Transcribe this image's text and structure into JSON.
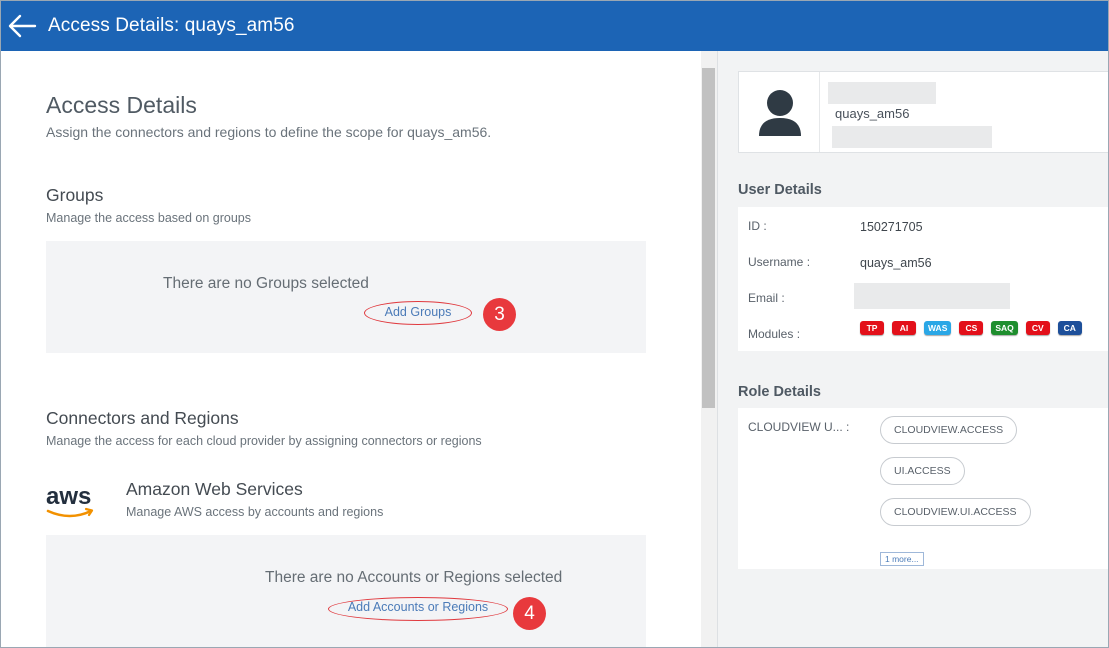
{
  "header": {
    "title": "Access Details: quays_am56"
  },
  "main": {
    "title": "Access Details",
    "subtitle": "Assign the connectors and regions to define the scope for quays_am56.",
    "groups": {
      "title": "Groups",
      "subtitle": "Manage the access based on groups",
      "empty_message": "There are no Groups selected",
      "add_label": "Add Groups",
      "step": "3"
    },
    "connectors": {
      "title": "Connectors and Regions",
      "subtitle": "Manage the access for each cloud provider by assigning connectors or regions",
      "aws": {
        "logo_text": "aws",
        "title": "Amazon Web Services",
        "subtitle": "Manage AWS access by accounts and regions",
        "empty_message": "There are no Accounts or Regions selected",
        "add_label": "Add Accounts or Regions",
        "step": "4"
      }
    }
  },
  "profile": {
    "username": "quays_am56"
  },
  "user_details": {
    "title": "User Details",
    "id_label": "ID",
    "id_value": "150271705",
    "username_label": "Username",
    "username_value": "quays_am56",
    "email_label": "Email",
    "modules_label": "Modules",
    "modules": [
      {
        "label": "TP",
        "color": "#e3101a"
      },
      {
        "label": "AI",
        "color": "#e3101a"
      },
      {
        "label": "WAS",
        "color": "#2aa7e6"
      },
      {
        "label": "CS",
        "color": "#e3101a"
      },
      {
        "label": "SAQ",
        "color": "#1e8e2e"
      },
      {
        "label": "CV",
        "color": "#e3101a"
      },
      {
        "label": "CA",
        "color": "#1d4f9a"
      }
    ]
  },
  "role_details": {
    "title": "Role Details",
    "role_label": "CLOUDVIEW U...",
    "permissions": [
      "CLOUDVIEW.ACCESS",
      "UI.ACCESS",
      "CLOUDVIEW.UI.ACCESS"
    ],
    "more_label": "1 more..."
  },
  "colors": {
    "header_bg": "#1c64b5",
    "link": "#4b7bb8",
    "step_badge": "#e8393d"
  }
}
